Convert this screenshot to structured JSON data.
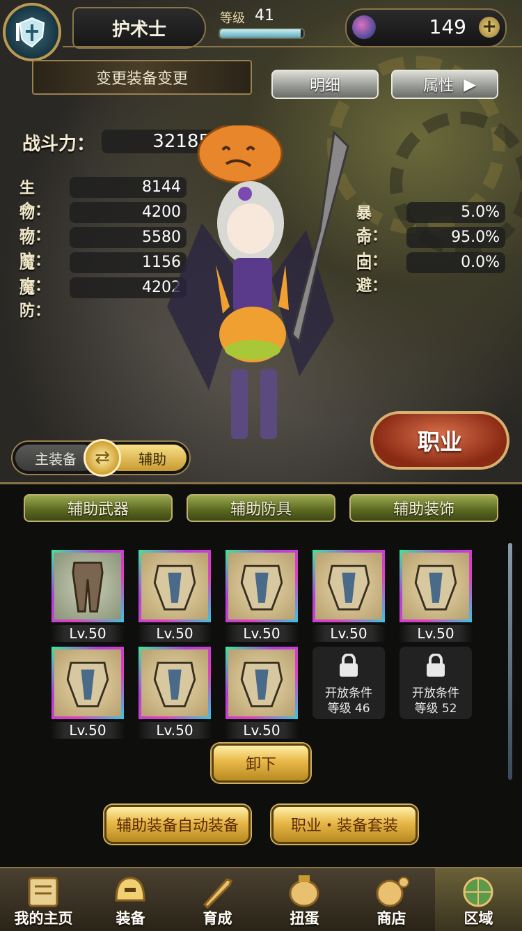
{
  "header": {
    "class_name": "护术士",
    "level_label": "等级",
    "level_value": "41",
    "xp_progress": 0.97,
    "gem_count": "149",
    "plus_symbol": "+"
  },
  "change_gear_label": "变更装备变更",
  "buttons": {
    "detail": "明细",
    "attributes": "属性",
    "career": "职业"
  },
  "power": {
    "label": "战斗力：",
    "value": "32185"
  },
  "stats_left": [
    {
      "label": "生命：",
      "value": "8144"
    },
    {
      "label": "物攻：",
      "value": "4200"
    },
    {
      "label": "物防：",
      "value": "5580"
    },
    {
      "label": "魔攻：",
      "value": "1156"
    },
    {
      "label": "魔防：",
      "value": "4202"
    }
  ],
  "stats_right": [
    {
      "label": "暴击：",
      "value": "5.0%"
    },
    {
      "label": "命中：",
      "value": "95.0%"
    },
    {
      "label": "回避：",
      "value": "0.0%"
    }
  ],
  "toggle": {
    "main": "主装备",
    "sub": "辅助",
    "selected": "sub"
  },
  "tabs": [
    "辅助武器",
    "辅助防具",
    "辅助装饰"
  ],
  "slots": [
    {
      "level": "Lv.50",
      "item": "pants-icon"
    },
    {
      "level": "Lv.50",
      "item": "armor-icon"
    },
    {
      "level": "Lv.50",
      "item": "armor-icon"
    },
    {
      "level": "Lv.50",
      "item": "armor-icon"
    },
    {
      "level": "Lv.50",
      "item": "armor-icon"
    },
    {
      "level": "Lv.50",
      "item": "armor-icon"
    },
    {
      "level": "Lv.50",
      "item": "armor-icon"
    },
    {
      "level": "Lv.50",
      "item": "armor-icon"
    }
  ],
  "locked_slots": [
    {
      "line1": "开放条件",
      "line2": "等级 46"
    },
    {
      "line1": "开放条件",
      "line2": "等级 52"
    }
  ],
  "actions": {
    "unequip": "卸下",
    "auto_equip": "辅助装备自动装备",
    "set_equip": "职业・装备套装"
  },
  "nav": [
    {
      "label": "我的主页",
      "icon": "scroll-icon"
    },
    {
      "label": "装备",
      "icon": "helmet-icon"
    },
    {
      "label": "育成",
      "icon": "sword-icon"
    },
    {
      "label": "扭蛋",
      "icon": "gacha-icon"
    },
    {
      "label": "商店",
      "icon": "coin-icon"
    },
    {
      "label": "区域",
      "icon": "globe-icon"
    }
  ],
  "colors": {
    "accent_gold": "#d8b070",
    "career_red": "#8a2a14",
    "tab_green": "#5a6820"
  }
}
